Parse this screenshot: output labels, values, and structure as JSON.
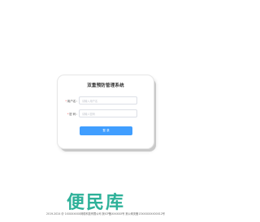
{
  "login": {
    "title": "双重预防管理系统",
    "username": {
      "required_mark": "*",
      "label": "用户名：",
      "placeholder": "请输入用户名"
    },
    "password": {
      "required_mark": "*",
      "label": "密 码：",
      "placeholder": "请输入密码"
    },
    "submit_label": "登 录"
  },
  "footer": {
    "copyright": "2019-2024 @ 1XXXXXXXX网络科技有限公司 冀ICP备XXXXXX号 冀公网安备13XXXXXXX00012号"
  },
  "watermark": {
    "text": "便民库"
  }
}
